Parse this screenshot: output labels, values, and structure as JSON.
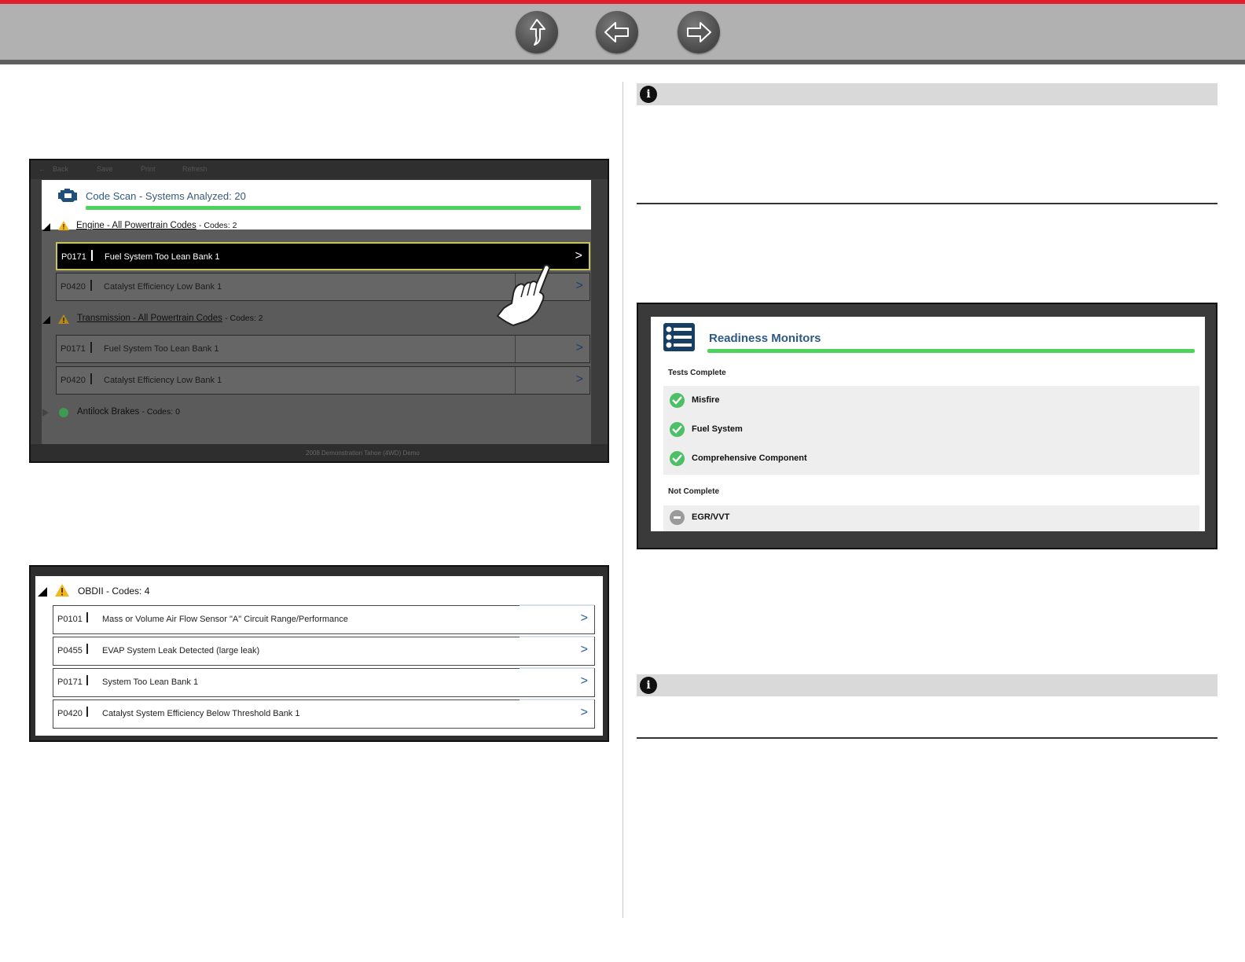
{
  "nav": {
    "up_icon": "up-arrow-icon",
    "back_icon": "left-arrow-icon",
    "forward_icon": "right-arrow-icon",
    "accent_color": "#e0202e"
  },
  "code_scan": {
    "toolbar": [
      "Back",
      "Save",
      "Print",
      "Refresh"
    ],
    "title": "Code Scan",
    "subtitle": "Systems Analyzed: 20",
    "groups": [
      {
        "name": "Engine - All Powertrain Codes",
        "count_label": "Codes: 2",
        "codes": [
          {
            "code": "P0171",
            "desc": "Fuel System Too Lean Bank 1",
            "selected": true
          },
          {
            "code": "P0420",
            "desc": "Catalyst Efficiency Low Bank 1",
            "selected": false
          }
        ]
      },
      {
        "name": "Transmission - All Powertrain Codes",
        "count_label": "Codes: 2",
        "codes": [
          {
            "code": "P0171",
            "desc": "Fuel System Too Lean Bank 1",
            "selected": false
          },
          {
            "code": "P0420",
            "desc": "Catalyst Efficiency Low Bank 1",
            "selected": false
          }
        ]
      },
      {
        "name": "Antilock Brakes",
        "count_label": "Codes: 0",
        "codes": []
      }
    ],
    "footer_vehicle": "2008 Demonstration Tahoe (4WD) Demo"
  },
  "obdii": {
    "title": "OBDII",
    "count_label": "Codes: 4",
    "codes": [
      {
        "code": "P0101",
        "desc": "Mass or Volume Air Flow Sensor \"A\" Circuit Range/Performance"
      },
      {
        "code": "P0455",
        "desc": "EVAP System Leak Detected (large leak)"
      },
      {
        "code": "P0171",
        "desc": "System Too Lean Bank 1"
      },
      {
        "code": "P0420",
        "desc": "Catalyst System Efficiency Below Threshold Bank 1"
      }
    ]
  },
  "readiness": {
    "title": "Readiness Monitors",
    "tests_complete_label": "Tests Complete",
    "complete": [
      "Misfire",
      "Fuel System",
      "Comprehensive Component"
    ],
    "not_complete_label": "Not Complete",
    "not_complete": [
      "EGR/VVT"
    ]
  },
  "info_icon": "info-icon"
}
